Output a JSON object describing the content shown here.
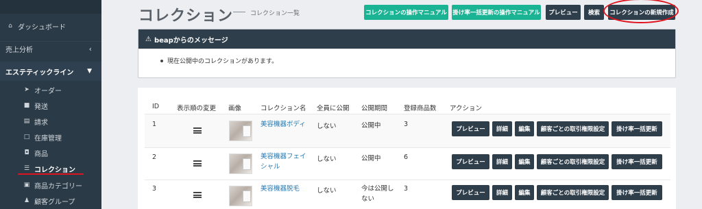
{
  "sidebar": {
    "dashboard": {
      "label": "ダッシュボード",
      "icon": "home-icon"
    },
    "sales_analysis": {
      "label": "売上分析",
      "icon": "chevron-left-icon"
    },
    "esthe_line": {
      "label": "エステティックライン",
      "icon": "chevron-down-icon"
    },
    "sub_items": [
      {
        "label": "オーダー",
        "icon": "paper-plane-icon"
      },
      {
        "label": "発送",
        "icon": "truck-icon"
      },
      {
        "label": "請求",
        "icon": "file-icon"
      },
      {
        "label": "在庫管理",
        "icon": "box-icon"
      },
      {
        "label": "商品",
        "icon": "bag-icon"
      },
      {
        "label": "コレクション",
        "icon": "list-icon"
      },
      {
        "label": "商品カテゴリー",
        "icon": "category-icon"
      },
      {
        "label": "顧客グループ",
        "icon": "users-icon"
      }
    ]
  },
  "header": {
    "title": "コレクション",
    "subtitle": "コレクション一覧",
    "buttons": {
      "manual": "コレクションの操作マニュアル",
      "rate_manual": "掛け率一括更新の操作マニュアル",
      "preview": "プレビュー",
      "search": "検索",
      "create": "コレクションの新規作成"
    }
  },
  "message": {
    "title": "beapからのメッセージ",
    "body": "現在公開中のコレクションがあります。"
  },
  "table": {
    "headers": [
      "ID",
      "表示順の変更",
      "画像",
      "コレクション名",
      "全員に公開",
      "公開期間",
      "登録商品数",
      "アクション"
    ],
    "action_labels": {
      "preview": "プレビュー",
      "detail": "詳細",
      "edit": "編集",
      "permission": "顧客ごとの取引権限設定",
      "rate_update": "掛け率一括更新"
    },
    "rows": [
      {
        "id": "1",
        "name_l1": "美容機器ボディ",
        "name_l2": "",
        "public": "しない",
        "period_l1": "公開中",
        "period_l2": "",
        "count": "3"
      },
      {
        "id": "2",
        "name_l1": "美容機器フェイ",
        "name_l2": "シャル",
        "public": "しない",
        "period_l1": "公開中",
        "period_l2": "",
        "count": "6"
      },
      {
        "id": "3",
        "name_l1": "美容機器脱毛",
        "name_l2": "",
        "public": "しない",
        "period_l1": "今は公開し",
        "period_l2": "ない",
        "count": "3"
      }
    ]
  },
  "colors": {
    "sidebar": "#2b3a47",
    "teal": "#1ab394",
    "dark_button": "#2f3e4b",
    "link": "#2a7ab0",
    "annotation_red": "#e0141e"
  }
}
